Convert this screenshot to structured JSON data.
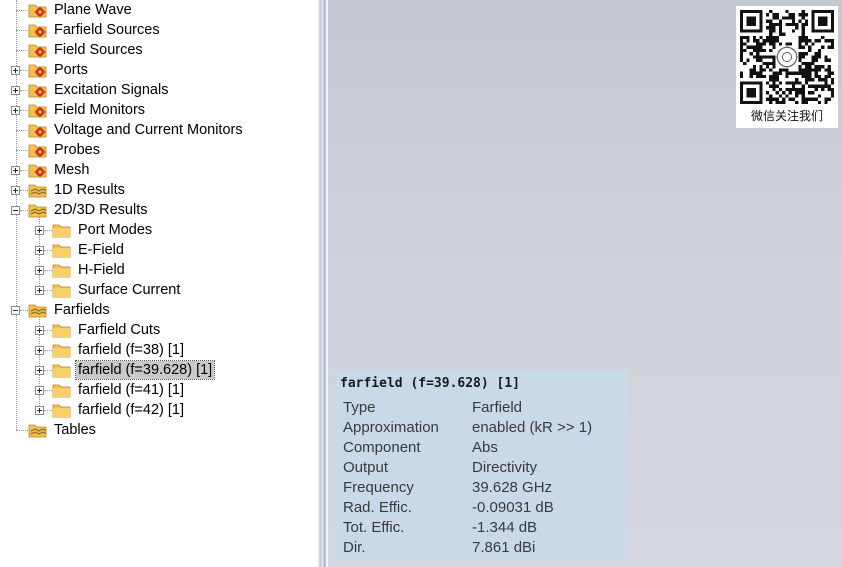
{
  "tree": {
    "items": [
      {
        "label": "Plane Wave",
        "icon": "source-folder-icon",
        "selected": false
      },
      {
        "label": "Farfield Sources",
        "icon": "source-folder-icon",
        "selected": false
      },
      {
        "label": "Field Sources",
        "icon": "source-folder-icon",
        "selected": false
      },
      {
        "label": "Ports",
        "icon": "source-folder-icon",
        "selected": false
      },
      {
        "label": "Excitation Signals",
        "icon": "source-folder-icon",
        "selected": false
      },
      {
        "label": "Field Monitors",
        "icon": "source-folder-icon",
        "selected": false
      },
      {
        "label": "Voltage and Current Monitors",
        "icon": "source-folder-icon",
        "selected": false
      },
      {
        "label": "Probes",
        "icon": "source-folder-icon",
        "selected": false
      },
      {
        "label": "Mesh",
        "icon": "source-folder-icon",
        "selected": false
      },
      {
        "label": "1D Results",
        "icon": "results-folder-icon",
        "selected": false
      },
      {
        "label": "2D/3D Results",
        "icon": "results-folder-icon",
        "selected": false
      },
      {
        "label": "Port Modes",
        "icon": "folder-icon",
        "selected": false
      },
      {
        "label": "E-Field",
        "icon": "folder-icon",
        "selected": false
      },
      {
        "label": "H-Field",
        "icon": "folder-icon",
        "selected": false
      },
      {
        "label": "Surface Current",
        "icon": "folder-icon",
        "selected": false
      },
      {
        "label": "Farfields",
        "icon": "results-folder-icon",
        "selected": false
      },
      {
        "label": "Farfield Cuts",
        "icon": "folder-icon",
        "selected": false
      },
      {
        "label": "farfield (f=38) [1]",
        "icon": "folder-icon",
        "selected": false
      },
      {
        "label": "farfield (f=39.628) [1]",
        "icon": "folder-icon",
        "selected": true
      },
      {
        "label": "farfield (f=41) [1]",
        "icon": "folder-icon",
        "selected": false
      },
      {
        "label": "farfield (f=42) [1]",
        "icon": "folder-icon",
        "selected": false
      },
      {
        "label": "Tables",
        "icon": "results-folder-icon",
        "selected": false
      }
    ]
  },
  "info": {
    "title": "farfield (f=39.628) [1]",
    "rows": [
      {
        "key": "Type",
        "value": "Farfield"
      },
      {
        "key": "Approximation",
        "value": "enabled (kR >> 1)"
      },
      {
        "key": "Component",
        "value": "Abs"
      },
      {
        "key": "Output",
        "value": "Directivity"
      },
      {
        "key": "Frequency",
        "value": "39.628 GHz"
      },
      {
        "key": "Rad. Effic.",
        "value": "-0.09031 dB"
      },
      {
        "key": "Tot. Effic.",
        "value": "-1.344 dB"
      },
      {
        "key": "Dir.",
        "value": "7.861 dBi"
      }
    ]
  },
  "qr": {
    "caption": "微信关注我们"
  },
  "colors": {
    "canvas_background": "#c8ccd4",
    "info_panel": "#cad9e8",
    "folder_yellow": "#f2c04b",
    "source_red": "#c8361e",
    "selection": "#c9c9c9"
  }
}
